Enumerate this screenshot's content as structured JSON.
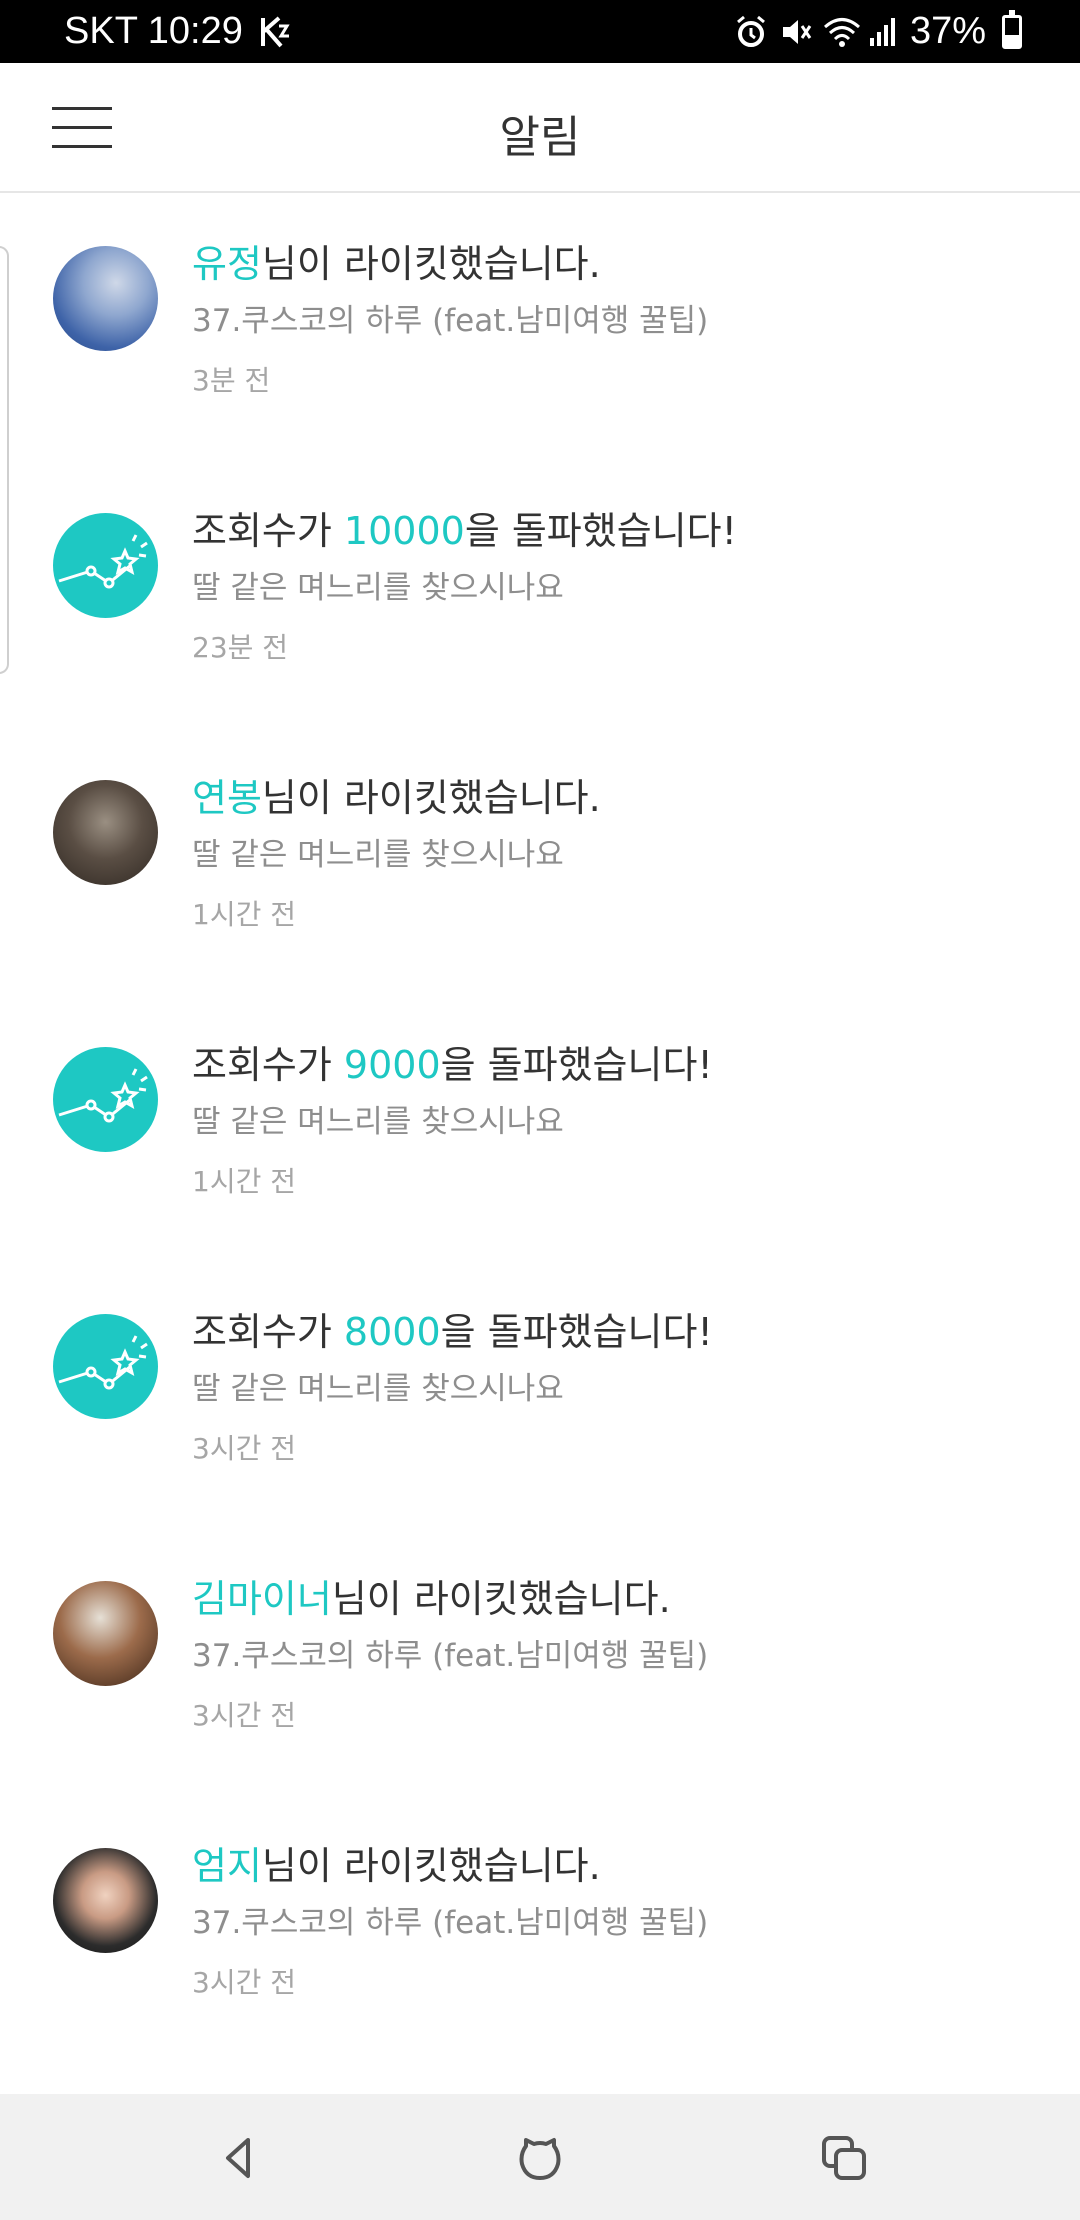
{
  "status_bar": {
    "carrier_time": "SKT 10:29",
    "battery_text": "37%",
    "battery_level": 0.37,
    "icons": [
      "signal-k-icon",
      "alarm-icon",
      "mute-icon",
      "wifi-icon",
      "cell-signal-icon",
      "battery-icon"
    ]
  },
  "app_bar": {
    "title": "알림",
    "menu_icon": "hamburger-icon"
  },
  "notifications": [
    {
      "avatar": "profile-photo",
      "highlight": "유정",
      "rest": "님이 라이킷했습니다.",
      "post": "37.쿠스코의 하루 (feat.남미여행 꿀팁)",
      "time": "3분 전"
    },
    {
      "avatar": "views-milestone-icon",
      "prefix": "조회수가 ",
      "highlight": "10000",
      "rest": "을 돌파했습니다!",
      "post": "딸 같은 며느리를 찾으시나요",
      "time": "23분 전"
    },
    {
      "avatar": "profile-photo",
      "highlight": "연봉",
      "rest": "님이 라이킷했습니다.",
      "post": "딸 같은 며느리를 찾으시나요",
      "time": "1시간 전"
    },
    {
      "avatar": "views-milestone-icon",
      "prefix": "조회수가 ",
      "highlight": "9000",
      "rest": "을 돌파했습니다!",
      "post": "딸 같은 며느리를 찾으시나요",
      "time": "1시간 전"
    },
    {
      "avatar": "views-milestone-icon",
      "prefix": "조회수가 ",
      "highlight": "8000",
      "rest": "을 돌파했습니다!",
      "post": "딸 같은 며느리를 찾으시나요",
      "time": "3시간 전"
    },
    {
      "avatar": "profile-photo",
      "highlight": "김마이너",
      "rest": "님이 라이킷했습니다.",
      "post": "37.쿠스코의 하루 (feat.남미여행 꿀팁)",
      "time": "3시간 전"
    },
    {
      "avatar": "profile-photo",
      "highlight": "엄지",
      "rest": "님이 라이킷했습니다.",
      "post": "37.쿠스코의 하루 (feat.남미여행 꿀팁)",
      "time": "3시간 전"
    }
  ],
  "nav_bar": {
    "icons": [
      "back-icon",
      "home-icon",
      "recents-icon"
    ]
  },
  "colors": {
    "accent": "#1ec8c3",
    "text_primary": "#333333",
    "text_secondary": "#8e8e8e",
    "text_time": "#a6a6a6",
    "navbar_bg": "#f1f1f1"
  }
}
